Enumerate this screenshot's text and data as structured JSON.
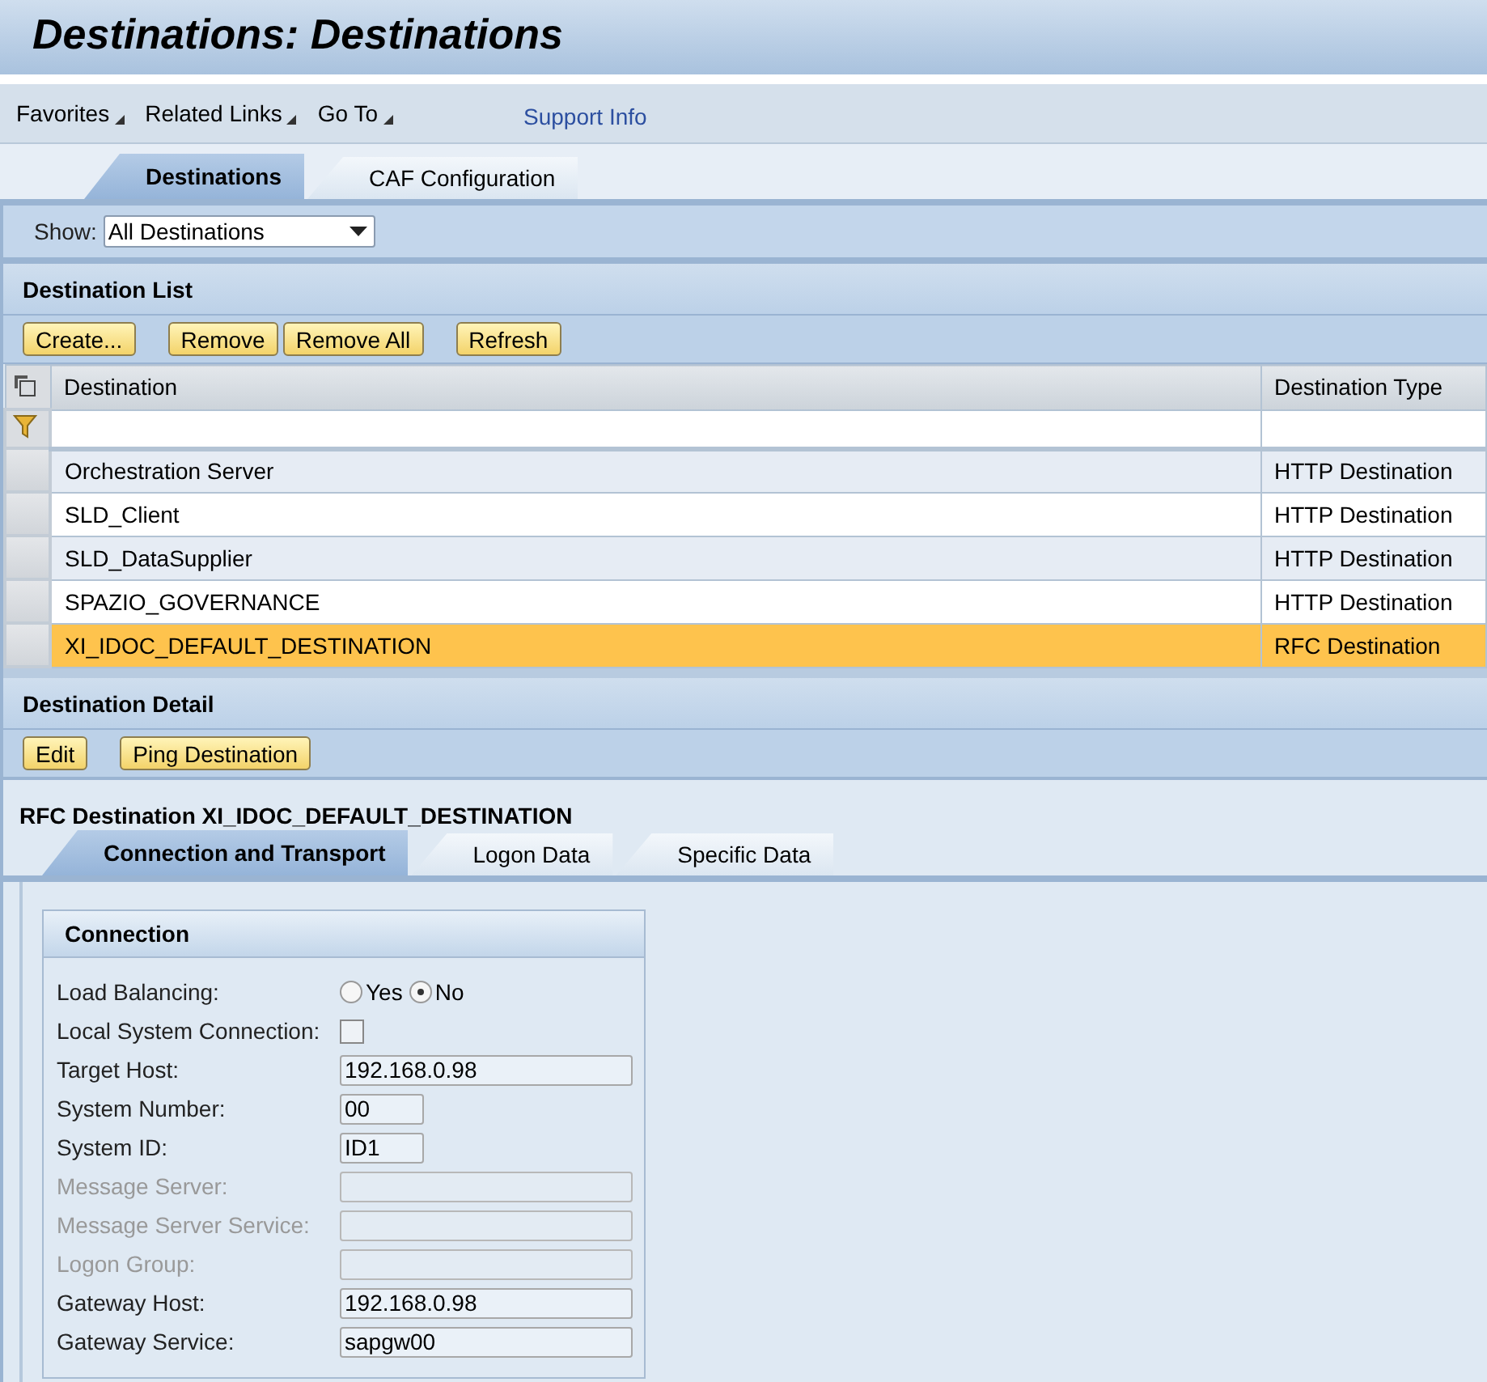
{
  "page_title": "Destinations: Destinations",
  "menu": [
    {
      "label": "Favorites",
      "kind": "dropdown"
    },
    {
      "label": "Related Links",
      "kind": "dropdown"
    },
    {
      "label": "Go To",
      "kind": "dropdown"
    },
    {
      "label": "Support Info",
      "kind": "link"
    }
  ],
  "tabs": [
    {
      "label": "Destinations",
      "selected": true
    },
    {
      "label": "CAF Configuration",
      "selected": false
    }
  ],
  "show": {
    "label": "Show:",
    "value": "All Destinations"
  },
  "destination_list": {
    "title": "Destination List",
    "button_groups": [
      [
        "Create..."
      ],
      [
        "Remove",
        "Remove All"
      ],
      [
        "Refresh"
      ]
    ],
    "table": {
      "columns": [
        "Destination",
        "Destination Type"
      ],
      "rows": [
        {
          "cells": [
            "Orchestration Server",
            "HTTP Destination"
          ],
          "selected": false
        },
        {
          "cells": [
            "SLD_Client",
            "HTTP Destination"
          ],
          "selected": false
        },
        {
          "cells": [
            "SLD_DataSupplier",
            "HTTP Destination"
          ],
          "selected": false
        },
        {
          "cells": [
            "SPAZIO_GOVERNANCE",
            "HTTP Destination"
          ],
          "selected": false
        },
        {
          "cells": [
            "XI_IDOC_DEFAULT_DESTINATION",
            "RFC Destination"
          ],
          "selected": true
        }
      ]
    }
  },
  "destination_detail": {
    "title": "Destination Detail",
    "button_groups": [
      [
        "Edit"
      ],
      [
        "Ping Destination"
      ]
    ],
    "heading": "RFC Destination XI_IDOC_DEFAULT_DESTINATION",
    "tabs": [
      {
        "label": "Connection and Transport",
        "selected": true
      },
      {
        "label": "Logon Data",
        "selected": false
      },
      {
        "label": "Specific Data",
        "selected": false
      }
    ],
    "group": {
      "title": "Connection",
      "fields": [
        {
          "kind": "radio",
          "label": "Load Balancing:",
          "options": [
            {
              "label": "Yes",
              "selected": false
            },
            {
              "label": "No",
              "selected": true
            }
          ]
        },
        {
          "kind": "checkbox",
          "label": "Local System Connection:",
          "checked": false
        },
        {
          "kind": "text",
          "label": "Target Host:",
          "value": "192.168.0.98",
          "disabled": false
        },
        {
          "kind": "short_text",
          "label": "System Number:",
          "value": "00",
          "disabled": false
        },
        {
          "kind": "short_text",
          "label": "System ID:",
          "value": "ID1",
          "disabled": false
        },
        {
          "kind": "text",
          "label": "Message Server:",
          "disabled": true
        },
        {
          "kind": "text",
          "label": "Message Server Service:",
          "disabled": true
        },
        {
          "kind": "text",
          "label": "Logon Group:",
          "disabled": true
        },
        {
          "kind": "text",
          "label": "Gateway Host:",
          "value": "192.168.0.98",
          "disabled": false
        },
        {
          "kind": "text",
          "label": "Gateway Service:",
          "value": "sapgw00",
          "disabled": false
        }
      ]
    }
  }
}
